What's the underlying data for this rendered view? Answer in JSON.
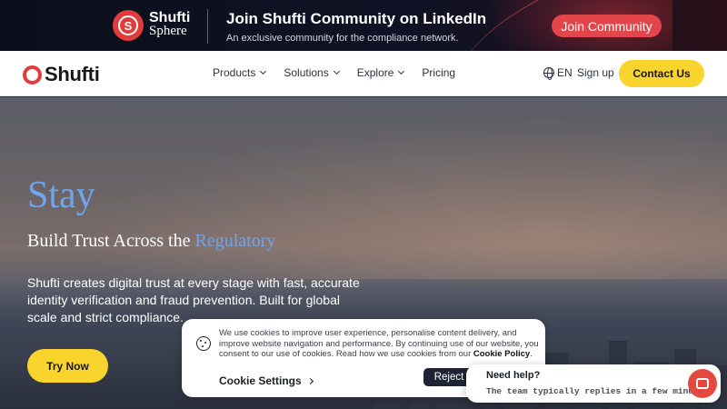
{
  "banner": {
    "logo_line1": "Shufti",
    "logo_line2": "Sphere",
    "title": "Join Shufti Community on LinkedIn",
    "subtitle": "An exclusive community for the compliance network.",
    "cta": "Join Community"
  },
  "nav": {
    "logo": "Shufti",
    "items": [
      {
        "label": "Products",
        "dropdown": true
      },
      {
        "label": "Solutions",
        "dropdown": true
      },
      {
        "label": "Explore",
        "dropdown": true
      },
      {
        "label": "Pricing",
        "dropdown": false
      }
    ],
    "language": "EN",
    "signup": "Sign up",
    "contact": "Contact Us"
  },
  "hero": {
    "heading": "Stay",
    "subheading_prefix": "Build Trust Across the ",
    "subheading_accent": "Regulatory",
    "paragraph": "Shufti creates digital trust at every stage with fast, accurate identity verification and fraud prevention. Built for global scale and strict compliance.",
    "cta": "Try Now"
  },
  "cookie": {
    "text": "We use cookies to improve user experience, personalise content delivery, and improve website navigation and performance. By continuing use of our website, you consent to our use of cookies. Read how we use cookies from our ",
    "policy_link": "Cookie Policy",
    "text_end": ".",
    "settings": "Cookie Settings",
    "reject": "Reject"
  },
  "chat": {
    "title": "Need help?",
    "subtitle": "The team typically replies in a few minutes."
  },
  "colors": {
    "brand_red": "#e23b3b",
    "accent_yellow": "#f8d42c",
    "accent_blue": "#6fa5ee",
    "banner_bg": "#0b0f1c"
  },
  "icons": {
    "logo": "shufti-logo-icon",
    "globe": "globe-icon",
    "cookie": "cookie-icon",
    "chat": "chat-bubble-icon"
  }
}
